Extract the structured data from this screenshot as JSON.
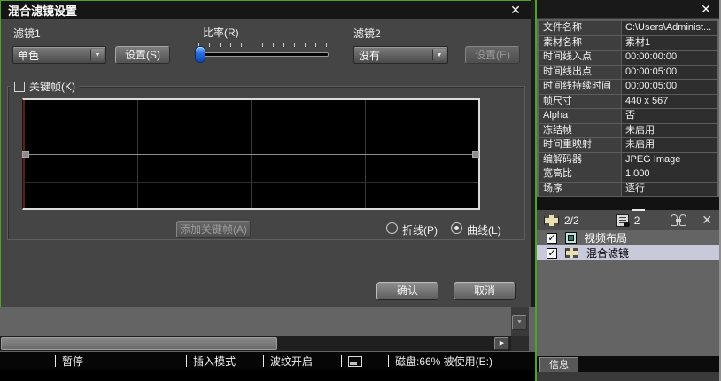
{
  "dialog": {
    "title": "混合滤镜设置",
    "filter1_label": "滤镜1",
    "filter1_value": "单色",
    "filter1_settings": "设置(S)",
    "ratio_label": "比率(R)",
    "filter2_label": "滤镜2",
    "filter2_value": "没有",
    "filter2_settings": "设置(E)",
    "keyframe_label": "关键帧(K)",
    "add_keyframe": "添加关键帧(A)",
    "radio_polyline": "折线(P)",
    "radio_curve": "曲线(L)",
    "confirm": "确认",
    "cancel": "取消"
  },
  "icons": {
    "close": "✕",
    "dropdown_arrow": "▼",
    "check": "✓",
    "scroll_right": "▶",
    "scroll_down": "▼"
  },
  "statusbar": {
    "pause": "暂停",
    "insert_mode": "插入模式",
    "ripple": "波纹开启",
    "disk": "磁盘:66% 被使用(E:)"
  },
  "panel": {
    "properties": [
      {
        "label": "文件名称",
        "value": "C:\\Users\\Administ..."
      },
      {
        "label": "素材名称",
        "value": "素材1"
      },
      {
        "label": "时间线入点",
        "value": "00:00:00:00"
      },
      {
        "label": "时间线出点",
        "value": "00:00:05:00"
      },
      {
        "label": "时间线持续时间",
        "value": "00:00:05:00"
      },
      {
        "label": "帧尺寸",
        "value": "440 x 567"
      },
      {
        "label": "Alpha",
        "value": "否"
      },
      {
        "label": "冻结帧",
        "value": "未启用"
      },
      {
        "label": "时间重映射",
        "value": "未启用"
      },
      {
        "label": "编解码器",
        "value": "JPEG Image"
      },
      {
        "label": "宽高比",
        "value": "1.000"
      },
      {
        "label": "场序",
        "value": "逐行"
      }
    ],
    "toolbar": {
      "filter_count": "2/2",
      "list_count": "2"
    },
    "filters": [
      {
        "label": "视频布局",
        "checked": true,
        "selected": false
      },
      {
        "label": "混合滤镜",
        "checked": true,
        "selected": true
      }
    ],
    "info_tab": "信息"
  },
  "colors": {
    "accent_green": "#4ea428",
    "selection_lavender": "#c9c9dc",
    "slider_blue": "#1d5fd3",
    "grid_red_line": "#5a1e16"
  }
}
